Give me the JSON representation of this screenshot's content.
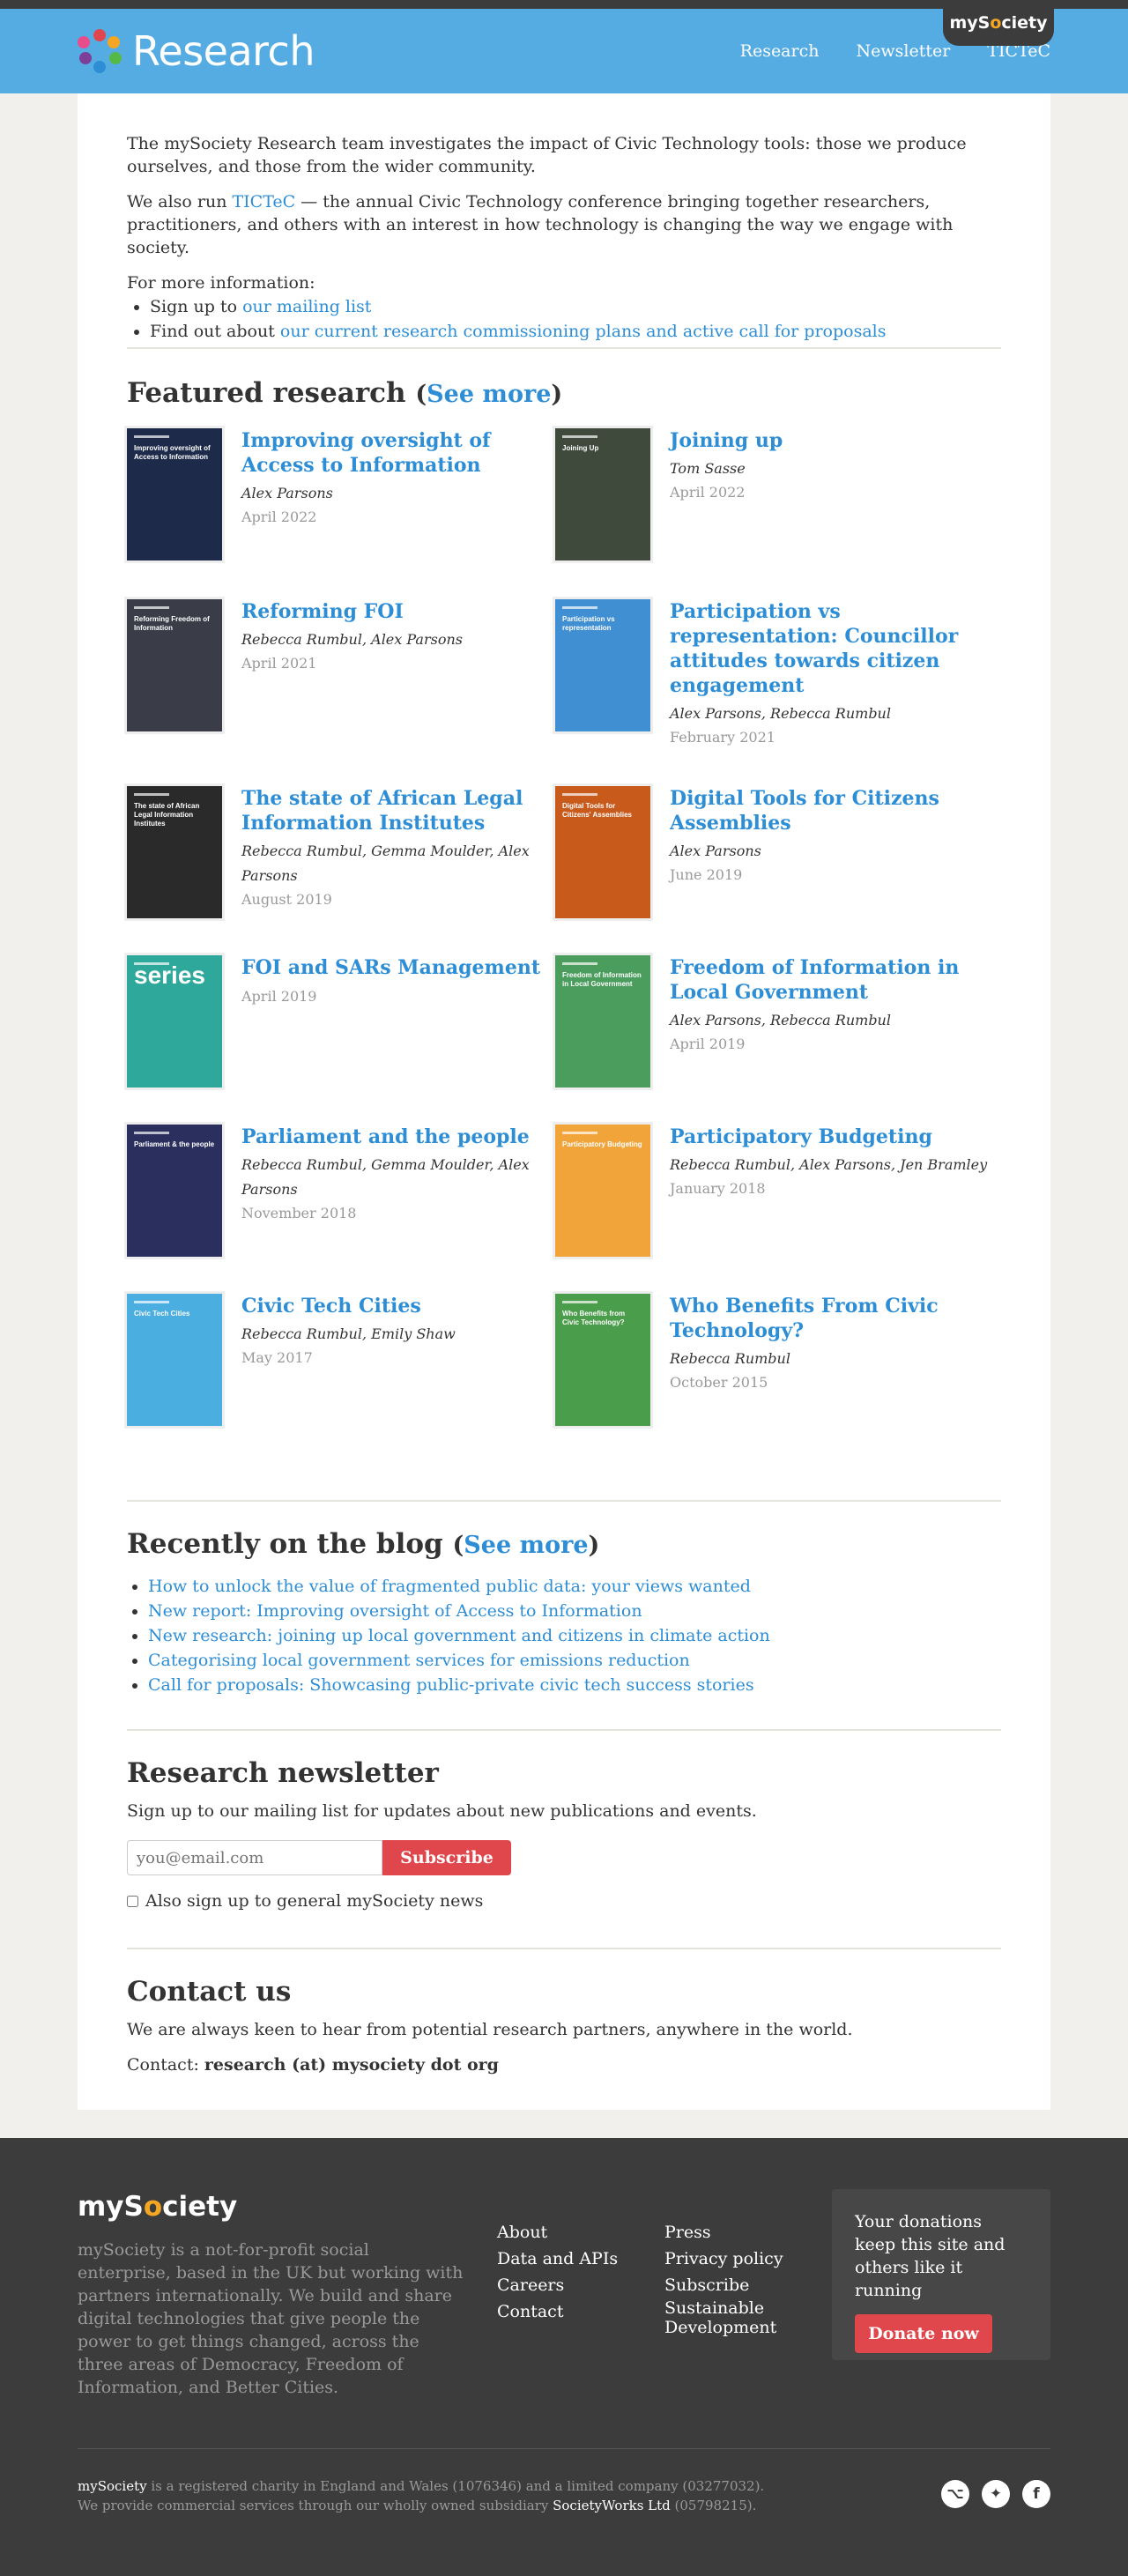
{
  "header": {
    "logo_text": "Research",
    "mysociety_tab_pre": "myS",
    "mysociety_tab_o": "o",
    "mysociety_tab_post": "ciety",
    "nav": [
      "Research",
      "Newsletter",
      "TICTeC"
    ]
  },
  "intro": {
    "p1": "The mySociety Research team investigates the impact of Civic Technology tools: those we produce ourselves, and those from the wider community.",
    "p2_pre": "We also run ",
    "p2_link": "TICTeC",
    "p2_post": " — the annual Civic Technology conference bringing together researchers, practitioners, and others with an interest in how technology is changing the way we engage with society.",
    "more_info": "For more information:",
    "bullet1_pre": "Sign up to ",
    "bullet1_link": "our mailing list",
    "bullet2_pre": "Find out about ",
    "bullet2_link": "our current research commissioning plans and active call for proposals"
  },
  "featured": {
    "heading": "Featured research",
    "see_more": "See more",
    "items": [
      {
        "title": "Improving oversight of Access to Information",
        "authors": "Alex Parsons",
        "date": "April 2022",
        "cover_color": "#1d2a4a",
        "cover_text": "Improving oversight of Access to Information"
      },
      {
        "title": "Joining up",
        "authors": "Tom Sasse",
        "date": "April 2022",
        "cover_color": "#3f4a3c",
        "cover_text": "Joining Up"
      },
      {
        "title": "Reforming FOI",
        "authors": "Rebecca Rumbul, Alex Parsons",
        "date": "April 2021",
        "cover_color": "#3a3c48",
        "cover_text": "Reforming Freedom of Information"
      },
      {
        "title": "Participation vs representation: Councillor attitudes towards citizen engagement",
        "authors": "Alex Parsons, Rebecca Rumbul",
        "date": "February 2021",
        "cover_color": "#3f8fd2",
        "cover_text": "Participation vs representation"
      },
      {
        "title": "The state of African Legal Information Institutes",
        "authors": "Rebecca Rumbul, Gemma Moulder, Alex Parsons",
        "date": "August 2019",
        "cover_color": "#2a2a2a",
        "cover_text": "The state of African Legal Information Institutes"
      },
      {
        "title": "Digital Tools for Citizens Assemblies",
        "authors": "Alex Parsons",
        "date": "June 2019",
        "cover_color": "#c85a1c",
        "cover_text": "Digital Tools for Citizens' Assemblies"
      },
      {
        "title": "FOI and SARs Management",
        "authors": "",
        "date": "April 2019",
        "cover_color": "#2ea89a",
        "cover_text": "series"
      },
      {
        "title": "Freedom of Information in Local Government",
        "authors": "Alex Parsons, Rebecca Rumbul",
        "date": "April 2019",
        "cover_color": "#4a9d5c",
        "cover_text": "Freedom of Information in Local Government"
      },
      {
        "title": "Parliament and the people",
        "authors": "Rebecca Rumbul, Gemma Moulder, Alex Parsons",
        "date": "November 2018",
        "cover_color": "#2b2f5e",
        "cover_text": "Parliament & the people"
      },
      {
        "title": "Participatory Budgeting",
        "authors": "Rebecca Rumbul, Alex Parsons, Jen Bramley",
        "date": "January 2018",
        "cover_color": "#f0a43a",
        "cover_text": "Participatory Budgeting"
      },
      {
        "title": "Civic Tech Cities",
        "authors": "Rebecca Rumbul, Emily Shaw",
        "date": "May 2017",
        "cover_color": "#4aaee0",
        "cover_text": "Civic Tech Cities"
      },
      {
        "title": "Who Benefits From Civic Technology?",
        "authors": "Rebecca Rumbul",
        "date": "October 2015",
        "cover_color": "#4a9d4a",
        "cover_text": "Who Benefits from Civic Technology?"
      }
    ]
  },
  "blog": {
    "heading": "Recently on the blog",
    "see_more": "See more",
    "posts": [
      "How to unlock the value of fragmented public data: your views wanted",
      "New report: Improving oversight of Access to Information",
      "New research: joining up local government and citizens in climate action",
      "Categorising local government services for emissions reduction",
      "Call for proposals: Showcasing public-private civic tech success stories"
    ]
  },
  "newsletter": {
    "heading": "Research newsletter",
    "desc": "Sign up to our mailing list for updates about new publications and events.",
    "placeholder": "you@email.com",
    "button": "Subscribe",
    "checkbox_label": "Also sign up to general mySociety news"
  },
  "contact": {
    "heading": "Contact us",
    "desc": "We are always keen to hear from potential research partners, anywhere in the world.",
    "label": "Contact:",
    "email": "research (at) mysociety dot org"
  },
  "footer": {
    "logo_pre": "myS",
    "logo_o": "o",
    "logo_post": "ciety",
    "about": "mySociety is a not-for-profit social enterprise, based in the UK but working with partners internationally. We build and share digital technologies that give people the power to get things changed, across the three areas of Democracy, Freedom of Information, and Better Cities.",
    "col1": [
      "About",
      "Data and APIs",
      "Careers",
      "Contact"
    ],
    "col2": [
      "Press",
      "Privacy policy",
      "Subscribe",
      "Sustainable Development"
    ],
    "donate_text": "Your donations keep this site and others like it running",
    "donate_button": "Donate now",
    "legal_name": "mySociety",
    "legal_1": " is a registered charity in England and Wales (1076346) and a limited company (03277032). We provide commercial services through our wholly owned subsidiary ",
    "legal_sub": "SocietyWorks Ltd",
    "legal_2": " (05798215).",
    "social": [
      "github-icon",
      "twitter-icon",
      "facebook-icon"
    ]
  }
}
